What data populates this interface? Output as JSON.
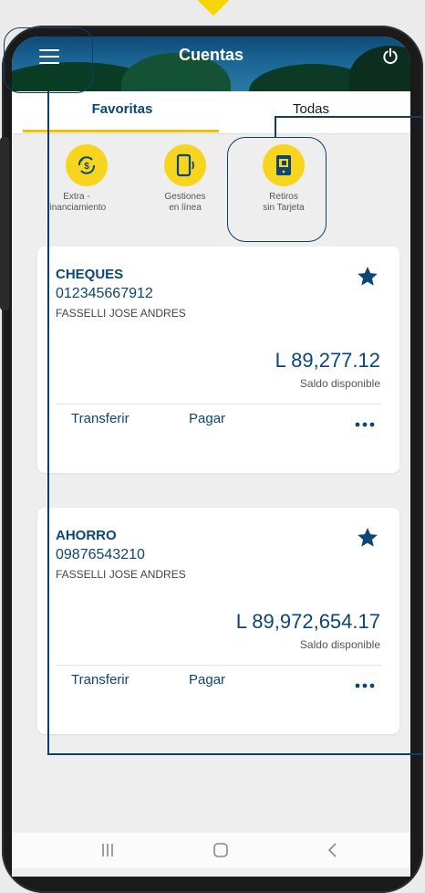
{
  "header": {
    "title": "Cuentas"
  },
  "tabs": [
    {
      "label": "Favoritas",
      "active": true
    },
    {
      "label": "Todas",
      "active": false
    }
  ],
  "shortcuts": [
    {
      "label": "Extra -\nfinanciamiento",
      "icon": "money-refresh-icon"
    },
    {
      "label": "Gestiones\nen línea",
      "icon": "phone-signal-icon"
    },
    {
      "label": "Retiros\nsin Tarjeta",
      "icon": "phone-card-icon"
    }
  ],
  "accounts": [
    {
      "type": "CHEQUES",
      "number": "012345667912",
      "holder": "FASSELLI JOSE ANDRES",
      "amount": "L 89,277.12",
      "available_label": "Saldo disponible",
      "transfer_label": "Transferir",
      "pay_label": "Pagar",
      "favorite": true
    },
    {
      "type": "AHORRO",
      "number": "09876543210",
      "holder": "FASSELLI JOSE ANDRES",
      "amount": "L 89,972,654.17",
      "available_label": "Saldo disponible",
      "transfer_label": "Transferir",
      "pay_label": "Pagar",
      "favorite": true
    }
  ],
  "colors": {
    "primary": "#0b4677",
    "accent": "#f7d51e",
    "tab_underline": "#f2c200"
  },
  "navbar": {
    "icons": [
      "recent-apps-icon",
      "home-icon",
      "back-icon"
    ]
  }
}
